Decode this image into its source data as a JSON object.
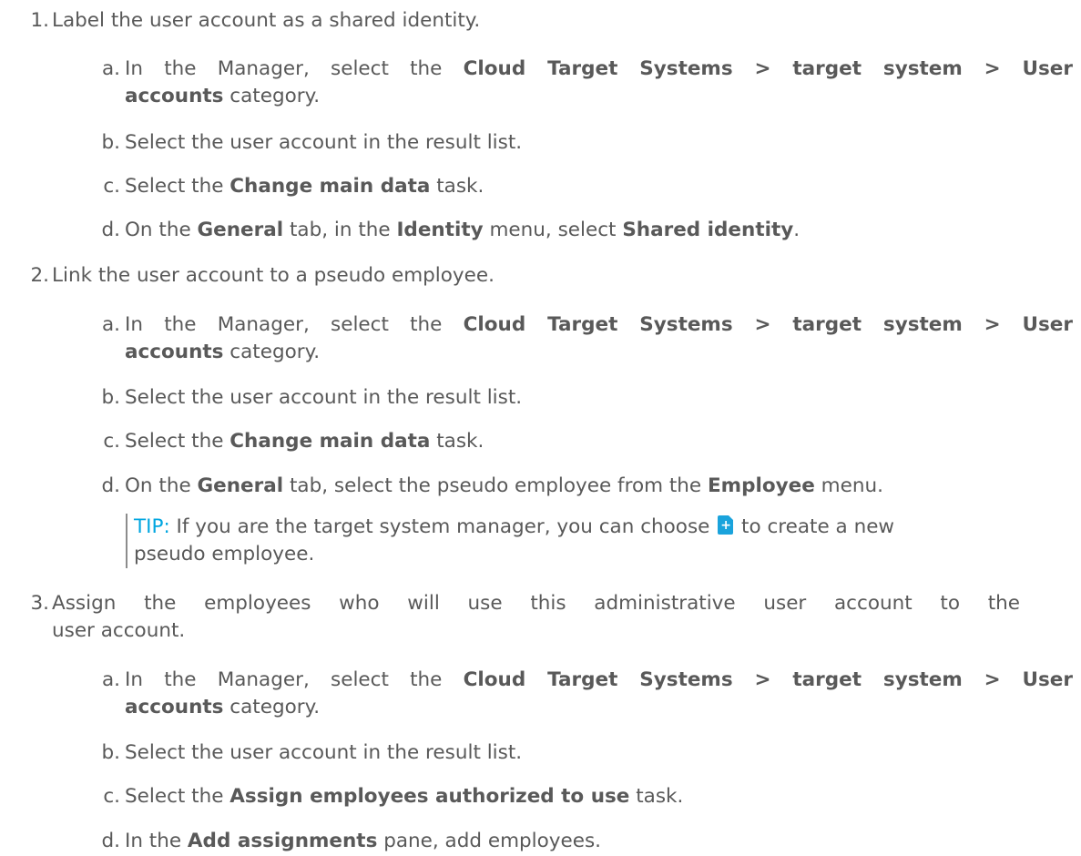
{
  "steps": [
    {
      "num": "1.",
      "text": "Label the user account as a shared identity.",
      "substeps": {
        "a": {
          "num": "a.",
          "pre": "In the Manager, select the ",
          "b1": "Cloud Target Systems > target system > User",
          "b2": "accounts",
          "post": " category."
        },
        "b": {
          "num": "b.",
          "text": "Select the user account in the result list."
        },
        "c": {
          "num": "c.",
          "pre": "Select the ",
          "bold": "Change main data",
          "post": " task."
        },
        "d": {
          "num": "d.",
          "pre": "On the ",
          "bold1": "General",
          "mid1": " tab, in the ",
          "bold2": "Identity",
          "mid2": " menu, select ",
          "bold3": "Shared identity",
          "post": "."
        }
      }
    },
    {
      "num": "2.",
      "text": "Link the user account to a pseudo employee.",
      "substeps": {
        "a": {
          "num": "a.",
          "pre": "In the Manager, select the ",
          "b1": "Cloud Target Systems > target system > User",
          "b2": "accounts",
          "post": " category."
        },
        "b": {
          "num": "b.",
          "text": "Select the user account in the result list."
        },
        "c": {
          "num": "c.",
          "pre": "Select the ",
          "bold": "Change main data",
          "post": " task."
        },
        "d": {
          "num": "d.",
          "pre": "On the ",
          "bold1": "General",
          "mid1": " tab, select the pseudo employee from the ",
          "bold2": "Employee",
          "post": " menu."
        }
      },
      "tip": {
        "label": "TIP:",
        "text1": " If you are the target system manager, you can choose ",
        "icon": "add-new-icon",
        "text2": " to create a new",
        "text3": "pseudo employee."
      }
    },
    {
      "num": "3.",
      "text1": "Assign the employees who will use this administrative user account to the",
      "text2": "user account.",
      "substeps": {
        "a": {
          "num": "a.",
          "pre": "In the Manager, select the ",
          "b1": "Cloud Target Systems > target system > User",
          "b2": "accounts",
          "post": " category."
        },
        "b": {
          "num": "b.",
          "text": "Select the user account in the result list."
        },
        "c": {
          "num": "c.",
          "pre": "Select the ",
          "bold": "Assign employees authorized to use",
          "post": " task."
        },
        "d": {
          "num": "d.",
          "pre": "In the ",
          "bold": "Add assignments",
          "post": " pane, add employees."
        }
      }
    }
  ],
  "colors": {
    "text": "#595959",
    "tip_label": "#00a6e0",
    "icon": "#1aa3dc"
  }
}
